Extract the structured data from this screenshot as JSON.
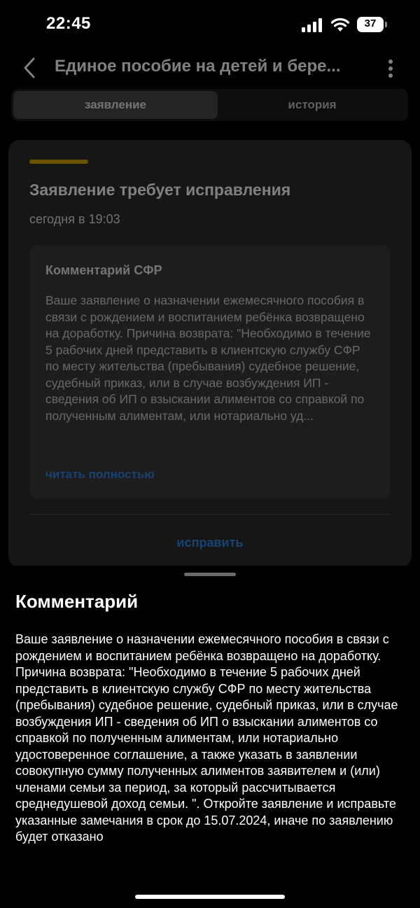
{
  "status_bar": {
    "time": "22:45",
    "battery": "37"
  },
  "nav": {
    "title": "Единое пособие на детей и бере..."
  },
  "tabs": [
    {
      "label": "заявление",
      "active": true
    },
    {
      "label": "история",
      "active": false
    }
  ],
  "card": {
    "status_title": "Заявление требует исправления",
    "date": "сегодня в 19:03",
    "comment_title": "Комментарий СФР",
    "comment_preview": "Ваше заявление о назначении ежемесячного пособия в связи с рождением и воспитанием ребёнка возвращено на доработку. Причина возврата: \"Необходимо в течение 5 рабочих дней представить в клиентскую службу СФР по месту жительства (пребывания) судебное решение, судебный приказ, или в случае возбуждения ИП - сведения об ИП о взыскании алиментов со справкой по полученным алиментам, или нотариально уд...",
    "read_more": "читать полностью",
    "fix_button": "исправить",
    "accent_color": "#d6a800"
  },
  "sheet": {
    "title": "Комментарий",
    "text": "Ваше заявление о назначении ежемесячного пособия в связи с рождением и воспитанием ребёнка возвращено на доработку. Причина возврата: \"Необходимо в течение 5 рабочих дней представить в клиентскую службу СФР по месту жительства (пребывания) судебное решение, судебный приказ, или в случае возбуждения ИП - сведения об ИП о взыскании алиментов со справкой по полученным алиментам, или нотариально удостоверенное соглашение, а также указать в заявлении совокупную сумму полученных алиментов заявителем и (или) членами семьи за период, за который рассчитывается среднедушевой доход семьи. \". Откройте заявление и исправьте указанные замечания в срок до 15.07.2024, иначе по заявлению будет отказано"
  },
  "colors": {
    "link": "#2f86e6",
    "background": "#000000",
    "card": "#2c2c2e"
  }
}
